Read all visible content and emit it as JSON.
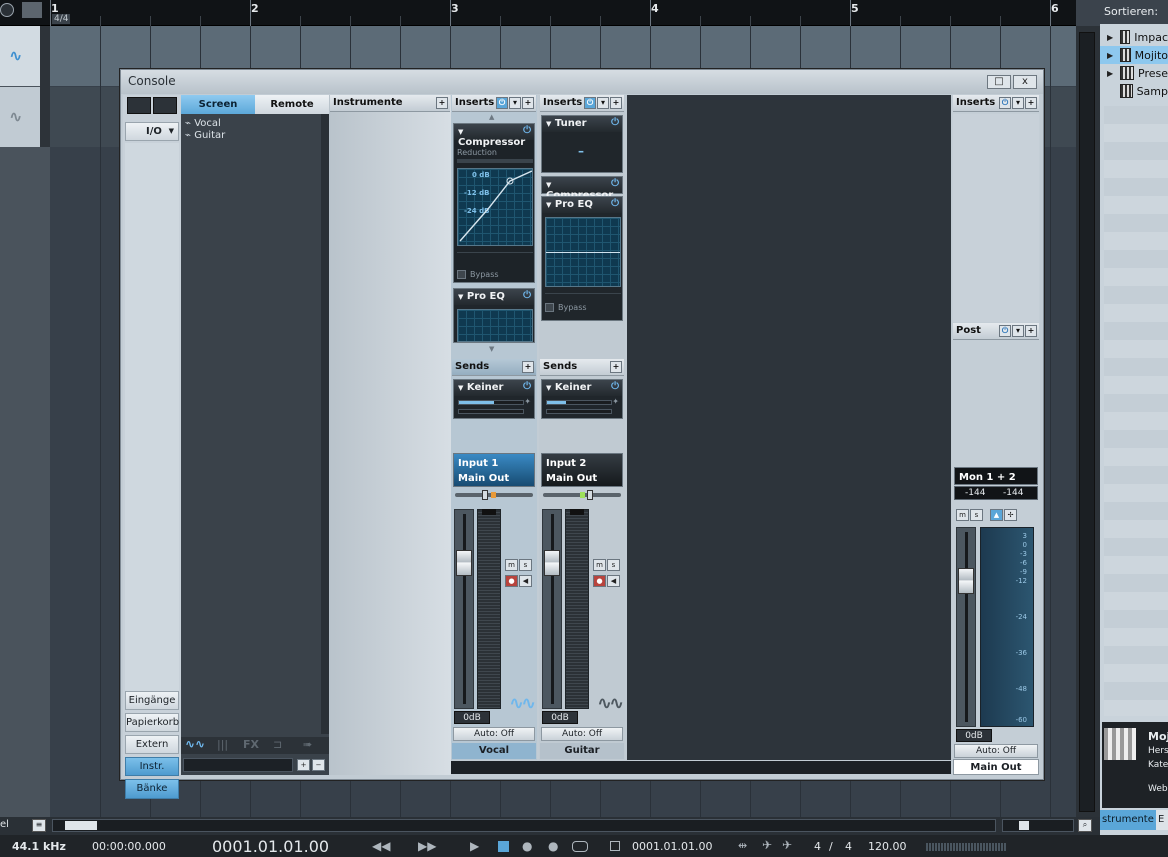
{
  "ruler": {
    "time_signature": "4/4",
    "bars": [
      "1",
      "2",
      "3",
      "4",
      "5",
      "6"
    ]
  },
  "browser": {
    "sort_label": "Sortieren:",
    "items": [
      {
        "label": "Impac",
        "selected": false,
        "expand": true
      },
      {
        "label": "Mojito",
        "selected": true,
        "expand": true
      },
      {
        "label": "Prese",
        "selected": false,
        "expand": true
      },
      {
        "label": "Samp",
        "selected": false,
        "expand": false
      }
    ],
    "info": {
      "title": "Moj",
      "lines": [
        "Hers",
        "Kate",
        "Web"
      ]
    },
    "tab_label": "strumente",
    "tab2_label": "E"
  },
  "console": {
    "title": "Console",
    "window_buttons": [
      "□",
      "x"
    ],
    "nav": {
      "io_label": "I/O",
      "buttons": [
        {
          "label": "Eingänge",
          "active": false
        },
        {
          "label": "Papierkorb",
          "active": false
        },
        {
          "label": "Extern",
          "active": false
        },
        {
          "label": "Instr.",
          "active": true
        },
        {
          "label": "Bänke",
          "active": true
        }
      ]
    },
    "list": {
      "tabs": [
        {
          "label": "Screen",
          "active": true
        },
        {
          "label": "Remote",
          "active": false
        }
      ],
      "items": [
        "Vocal",
        "Guitar"
      ]
    },
    "instruments_label": "Instrumente",
    "channels": [
      {
        "name": "Vocal",
        "inserts_label": "Inserts",
        "plugins": [
          {
            "name": "Compressor",
            "reduction_label": "Reduction",
            "db_labels": [
              "0 dB",
              "-12 dB",
              "-24 dB"
            ],
            "bypass_label": "Bypass"
          },
          {
            "name": "Pro EQ"
          }
        ],
        "sends_label": "Sends",
        "send_name": "Keiner",
        "send_level": 0.55,
        "input": "Input 1",
        "output": "Main Out",
        "volume": "0dB",
        "automation": "Auto: Off",
        "accent": "#7fb3d6"
      },
      {
        "name": "Guitar",
        "inserts_label": "Inserts",
        "plugins": [
          {
            "name": "Tuner",
            "readout": "–"
          },
          {
            "name": "Compressor"
          },
          {
            "name": "Pro EQ",
            "bypass_label": "Bypass"
          }
        ],
        "sends_label": "Sends",
        "send_name": "Keiner",
        "send_level": 0.3,
        "input": "Input 2",
        "output": "Main Out",
        "volume": "0dB",
        "automation": "Auto: Off",
        "accent": "#c0cad2"
      }
    ],
    "main": {
      "inserts_label": "Inserts",
      "post_label": "Post",
      "output_name": "Mon 1 + 2",
      "peak_left": "-144",
      "peak_right": "-144",
      "volume": "0dB",
      "automation": "Auto: Off",
      "name": "Main Out",
      "db_scale": [
        "3",
        "0",
        "-3",
        "-6",
        "-9",
        "-12",
        "-24",
        "-36",
        "-48",
        "-60"
      ]
    }
  },
  "transport": {
    "sample_rate": "44.1 kHz",
    "time": "00:00:00.000",
    "position": "0001.01.01.00",
    "loop_position": "0001.01.01.00",
    "signature_num": "4",
    "signature_sep": "/",
    "signature_den": "4",
    "tempo": "120.00"
  },
  "colors": {
    "accent": "#6fb7ec",
    "active_nav": "#5aa6d8",
    "background": "#3b434c"
  }
}
